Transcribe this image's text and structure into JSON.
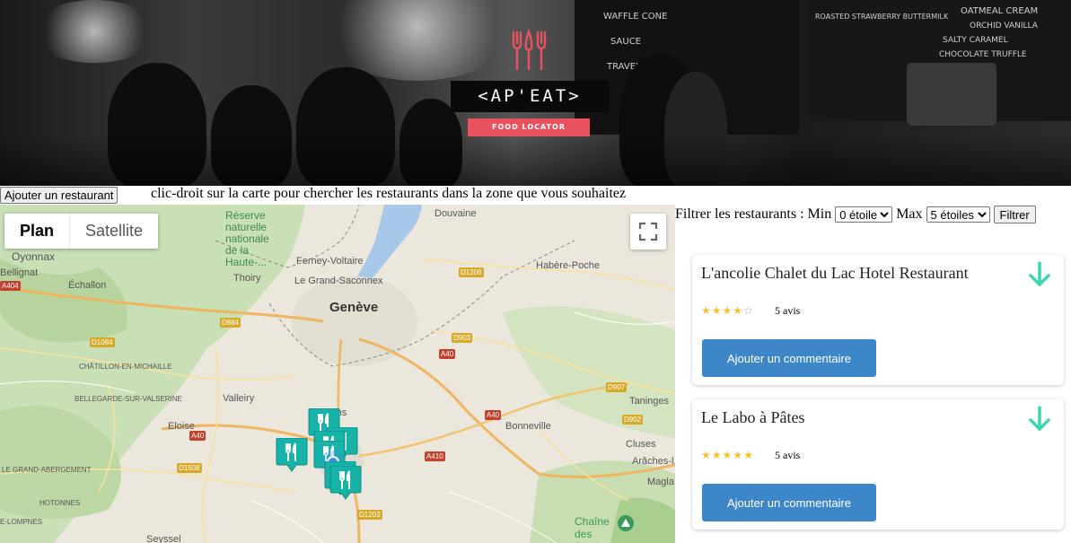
{
  "hero": {
    "brand": "<AP'EAT>",
    "tagline": "FOOD LOCATOR",
    "chalkboard_lines": [
      "WAFFLE CONE",
      "SAUCE",
      "TRAVEL",
      "ROASTED STRAWBERRY BUTTERMILK",
      "OATMEAL CREAM",
      "ORCHID VANILLA",
      "SALTY CARAMEL",
      "CHOCOLATE TRUFFLE"
    ]
  },
  "toolbar": {
    "add_button": "Ajouter un restaurant",
    "hint": "clic-droit sur la carte pour chercher les restaurants dans la zone que vous souhaitez"
  },
  "map": {
    "type_plan": "Plan",
    "type_satellite": "Satellite",
    "places": {
      "geneve": "Genève",
      "douvaine": "Douvaine",
      "ferney": "Ferney-Voltaire",
      "grand_saconnex": "Le Grand-Saconnex",
      "thoiry": "Thoiry",
      "oyonnax": "Oyonnax",
      "bellignat": "Bellignat",
      "echallon": "Échallon",
      "chatillon": "CHÂTILLON-EN-MICHAILLE",
      "bellegarde": "BELLEGARDE-SUR-VALSERINE",
      "vallery": "Valleiry",
      "neydens": "Neydens",
      "eloise": "Eloise",
      "grand_abergement": "LE GRAND-ABERGEMENT",
      "hotonnes": "HOTONNES",
      "lompnes": "E-LOMPNES",
      "seyssel": "Seyssel",
      "boege": "Habère-Poche",
      "taninges": "Taninges",
      "bonneville": "Bonneville",
      "cluses": "Cluses",
      "araches": "Arâches-l...",
      "magland": "Magla",
      "aravis": "Chaîne des Aravis",
      "reserve": "Réserve naturelle nationale de la Haute-..."
    },
    "roads": [
      "A404",
      "D884",
      "D1084",
      "D1206",
      "D903",
      "A40",
      "D907",
      "D902",
      "A410",
      "D1508",
      "D1203",
      "A40",
      "A40"
    ]
  },
  "filter": {
    "label": "Filtrer les restaurants : Min",
    "max_label": "Max",
    "min_value": "0 étoile",
    "max_value": "5 étoiles",
    "button": "Filtrer"
  },
  "restaurants": [
    {
      "name": "L'ancolie Chalet du Lac Hotel Restaurant",
      "rating": 4,
      "reviews": "5 avis",
      "comment_button": "Ajouter un commentaire"
    },
    {
      "name": "Le Labo à Pâtes",
      "rating": 5,
      "reviews": "5 avis",
      "comment_button": "Ajouter un commentaire"
    }
  ],
  "colors": {
    "accent_teal": "#3dd6b0",
    "brand_red": "#e9515f",
    "button_blue": "#3d87c9",
    "star": "#f5c12e",
    "pin": "#17b3a8"
  }
}
